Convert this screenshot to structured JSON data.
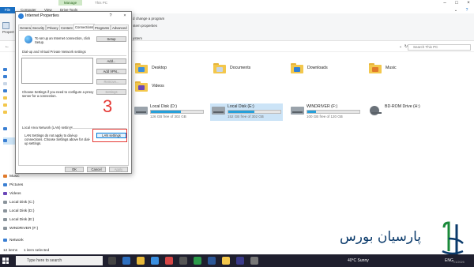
{
  "explorer": {
    "manage_tab": "Manage",
    "window_title": "This PC",
    "ribbon_tabs": [
      "File",
      "Computer",
      "View",
      "Drive Tools"
    ],
    "ribbon_items": {
      "properties": "Propert",
      "change_program": "d change a program",
      "system_properties": "stem properties",
      "system": "ystem"
    },
    "search_placeholder": "Search This PC",
    "sidebar": [
      {
        "label": "Music",
        "color": "#e07a2b"
      },
      {
        "label": "Pictures",
        "color": "#3a7fd3"
      },
      {
        "label": "Videos",
        "color": "#6b47b8"
      },
      {
        "label": "Local Disk (C:)",
        "color": "#8a939b"
      },
      {
        "label": "Local Disk (D:)",
        "color": "#8a939b"
      },
      {
        "label": "Local Disk (E:)",
        "color": "#8a939b"
      },
      {
        "label": "WINDRIVER (F:)",
        "color": "#8a939b"
      },
      {
        "label": "Network",
        "color": "#3a7fd3"
      }
    ],
    "folders": [
      {
        "name": "Desktop",
        "badge": "#3a8fe0"
      },
      {
        "name": "Documents",
        "badge": "#c9d6e6"
      },
      {
        "name": "Downloads",
        "badge": "#2f7fd6"
      },
      {
        "name": "Music",
        "badge": "#e07a2b"
      },
      {
        "name": "Videos",
        "badge": "#6b47b8"
      }
    ],
    "drives": [
      {
        "name": "Local Disk (D:)",
        "free": "126 GB free of 302 GB",
        "used_fraction": 0.58,
        "selected": false
      },
      {
        "name": "Local Disk (E:)",
        "free": "152 GB free of 302 GB",
        "used_fraction": 0.5,
        "selected": true
      },
      {
        "name": "WINDRIVER (F:)",
        "free": "100 GB free of 120 GB",
        "used_fraction": 0.17,
        "selected": false
      },
      {
        "name": "BD-ROM Drive (H:)",
        "free": "",
        "used_fraction": null,
        "selected": false
      }
    ],
    "status": {
      "items": "12 items",
      "selected": "1 item selected"
    }
  },
  "dialog": {
    "title": "Internet Properties",
    "help": "?",
    "close": "×",
    "tabs": [
      "General",
      "Security",
      "Privacy",
      "Content",
      "Connections",
      "Programs",
      "Advanced"
    ],
    "active_tab": "Connections",
    "setup_text": "To set up an Internet connection, click Setup.",
    "setup_button": "Setup",
    "dialup_group": "Dial-up and Virtual Private Network settings",
    "add_button": "Add...",
    "add_vpn_button": "Add VPN...",
    "remove_button": "Remove...",
    "settings_button": "Settings",
    "proxy_text": "Choose Settings if you need to configure a proxy server for a connection.",
    "lan_group": "Local Area Network (LAN) settings",
    "lan_text": "LAN Settings do not apply to dial-up connections. Choose Settings above for dial-up settings.",
    "lan_button": "LAN settings",
    "ok_button": "OK",
    "cancel_button": "Cancel",
    "apply_button": "Apply"
  },
  "annotation": {
    "step_number": "3",
    "color": "#e53935"
  },
  "brand": {
    "text": "پارسیان بورس"
  },
  "taskbar": {
    "search_placeholder": "Type here to search",
    "weather": "40°C  Sunny",
    "language": "ENG",
    "date": "7/1/2025"
  }
}
